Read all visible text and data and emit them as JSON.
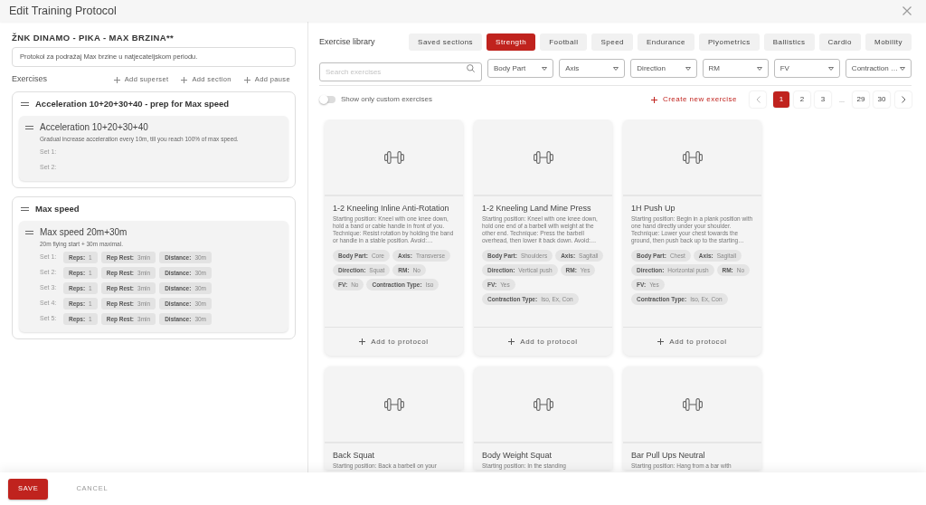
{
  "window": {
    "title": "Edit Training Protocol"
  },
  "protocol": {
    "name": "ŽNK DINAMO - PIKA - MAX BRZINA**",
    "description": "Protokol za podražaj Max brzine u natjecateljskom periodu."
  },
  "exercises_panel": {
    "title": "Exercises",
    "actions": [
      "Add superset",
      "Add section",
      "Add pause"
    ],
    "sections": [
      {
        "title": "Acceleration 10+20+30+40 - prep for Max speed",
        "exercises": [
          {
            "title": "Acceleration 10+20+30+40",
            "description": "Gradual increase acceleration every 10m, till you reach 100% of max speed.",
            "sets": [
              {
                "label": "Set 1:"
              },
              {
                "label": "Set 2:"
              }
            ]
          }
        ]
      },
      {
        "title": "Max speed",
        "exercises": [
          {
            "title": "Max speed 20m+30m",
            "description": "20m flying start + 30m maximal.",
            "sets": [
              {
                "label": "Set 1:",
                "params": [
                  {
                    "name": "Reps:",
                    "value": "1"
                  },
                  {
                    "name": "Rep Rest:",
                    "value": "3min"
                  },
                  {
                    "name": "Distance:",
                    "value": "30m"
                  }
                ]
              },
              {
                "label": "Set 2:",
                "params": [
                  {
                    "name": "Reps:",
                    "value": "1"
                  },
                  {
                    "name": "Rep Rest:",
                    "value": "3min"
                  },
                  {
                    "name": "Distance:",
                    "value": "30m"
                  }
                ]
              },
              {
                "label": "Set 3:",
                "params": [
                  {
                    "name": "Reps:",
                    "value": "1"
                  },
                  {
                    "name": "Rep Rest:",
                    "value": "3min"
                  },
                  {
                    "name": "Distance:",
                    "value": "30m"
                  }
                ]
              },
              {
                "label": "Set 4:",
                "params": [
                  {
                    "name": "Reps:",
                    "value": "1"
                  },
                  {
                    "name": "Rep Rest:",
                    "value": "3min"
                  },
                  {
                    "name": "Distance:",
                    "value": "30m"
                  }
                ]
              },
              {
                "label": "Set 5:",
                "params": [
                  {
                    "name": "Reps:",
                    "value": "1"
                  },
                  {
                    "name": "Rep Rest:",
                    "value": "3min"
                  },
                  {
                    "name": "Distance:",
                    "value": "30m"
                  }
                ]
              }
            ]
          }
        ]
      }
    ]
  },
  "library": {
    "title": "Exercise library",
    "tabs": [
      {
        "label": "Saved sections",
        "selected": false
      },
      {
        "label": "Strength",
        "selected": true
      },
      {
        "label": "Football",
        "selected": false
      },
      {
        "label": "Speed",
        "selected": false
      },
      {
        "label": "Endurance",
        "selected": false
      },
      {
        "label": "Plyometrics",
        "selected": false
      },
      {
        "label": "Ballistics",
        "selected": false
      },
      {
        "label": "Cardio",
        "selected": false
      },
      {
        "label": "Mobility",
        "selected": false
      }
    ],
    "search": {
      "placeholder": "Search exercises"
    },
    "filters": [
      "Body Part",
      "Axis",
      "Direction",
      "RM",
      "FV",
      "Contraction …"
    ],
    "custom_toggle": {
      "label": "Show only custom exercises",
      "on": false
    },
    "create_label": "Create new exercise",
    "pagination": {
      "pages": [
        {
          "kind": "page",
          "label": "1",
          "selected": true
        },
        {
          "kind": "page",
          "label": "2",
          "selected": false
        },
        {
          "kind": "page",
          "label": "3",
          "selected": false
        },
        {
          "kind": "ellipsis",
          "label": "..."
        },
        {
          "kind": "page",
          "label": "29",
          "selected": false
        },
        {
          "kind": "page",
          "label": "30",
          "selected": false
        }
      ]
    },
    "cards": [
      {
        "title": "1-2 Kneeling Inline Anti-Rotation",
        "description": "Starting position: Kneel with one knee down, hold a band or cable handle in front of you. Technique: Resist rotation by holding the band or handle in a stable position. Avoid:…",
        "tags": [
          {
            "name": "Body Part:",
            "value": "Core"
          },
          {
            "name": "Axis:",
            "value": "Transverse"
          },
          {
            "name": "Direction:",
            "value": "Squat"
          },
          {
            "name": "RM:",
            "value": "No"
          },
          {
            "name": "FV:",
            "value": "No"
          },
          {
            "name": "Contraction Type:",
            "value": "Iso"
          }
        ],
        "action": "Add to protocol"
      },
      {
        "title": "1-2 Kneeling Land Mine Press",
        "description": "Starting position: Kneel with one knee down, hold one end of a barbell with weight at the other end. Technique: Press the barbell overhead, then lower it back down. Avoid:…",
        "tags": [
          {
            "name": "Body Part:",
            "value": "Shoulders"
          },
          {
            "name": "Axis:",
            "value": "Sagitall"
          },
          {
            "name": "Direction:",
            "value": "Vertical push"
          },
          {
            "name": "RM:",
            "value": "Yes"
          },
          {
            "name": "FV:",
            "value": "Yes"
          },
          {
            "name": "Contraction Type:",
            "value": "Iso, Ex, Con"
          }
        ],
        "action": "Add to protocol"
      },
      {
        "title": "1H Push Up",
        "description": "Starting position: Begin in a plank position with one hand directly under your shoulder. Technique: Lower your chest towards the ground, then push back up to the starting…",
        "tags": [
          {
            "name": "Body Part:",
            "value": "Chest"
          },
          {
            "name": "Axis:",
            "value": "Sagitall"
          },
          {
            "name": "Direction:",
            "value": "Horizontal push"
          },
          {
            "name": "RM:",
            "value": "No"
          },
          {
            "name": "FV:",
            "value": "Yes"
          },
          {
            "name": "Contraction Type:",
            "value": "Iso, Ex, Con"
          }
        ],
        "action": "Add to protocol"
      },
      {
        "title": "Back Squat",
        "description": "Starting position: Back a barbell on your"
      },
      {
        "title": "Body Weight Squat",
        "description": "Starting position: In the standing"
      },
      {
        "title": "Bar Pull Ups Neutral",
        "description": "Starting position: Hang from a bar with"
      }
    ]
  },
  "footer": {
    "buttons": [
      {
        "label": "SAVE",
        "kind": "primary"
      },
      {
        "label": "CANCEL",
        "kind": "secondary"
      }
    ]
  }
}
